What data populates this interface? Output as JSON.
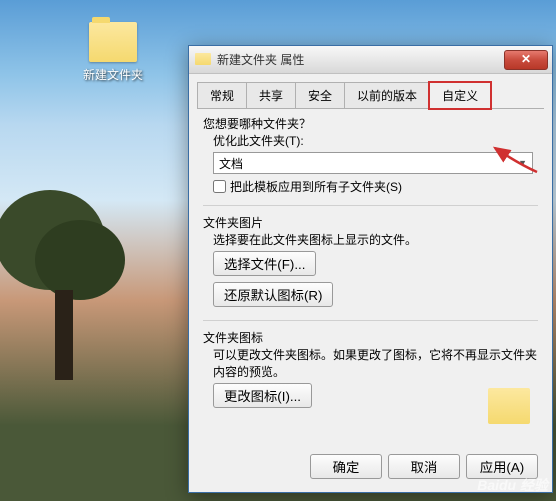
{
  "desktop": {
    "icon_label": "新建文件夹"
  },
  "dialog": {
    "title": "新建文件夹 属性"
  },
  "tabs": [
    {
      "label": "常规"
    },
    {
      "label": "共享"
    },
    {
      "label": "安全"
    },
    {
      "label": "以前的版本"
    },
    {
      "label": "自定义"
    }
  ],
  "customize": {
    "q1": "您想要哪种文件夹？",
    "opt_label": "优化此文件夹(T):",
    "opt_value": "文档",
    "apply_sub": "把此模板应用到所有子文件夹(S)",
    "pic_header": "文件夹图片",
    "pic_desc": "选择要在此文件夹图标上显示的文件。",
    "choose_file": "选择文件(F)...",
    "restore_default": "还原默认图标(R)",
    "icon_header": "文件夹图标",
    "icon_desc": "可以更改文件夹图标。如果更改了图标，它将不再显示文件夹内容的预览。",
    "change_icon": "更改图标(I)..."
  },
  "buttons": {
    "ok": "确定",
    "cancel": "取消",
    "apply": "应用(A)"
  },
  "watermark": "Baidu 经验"
}
